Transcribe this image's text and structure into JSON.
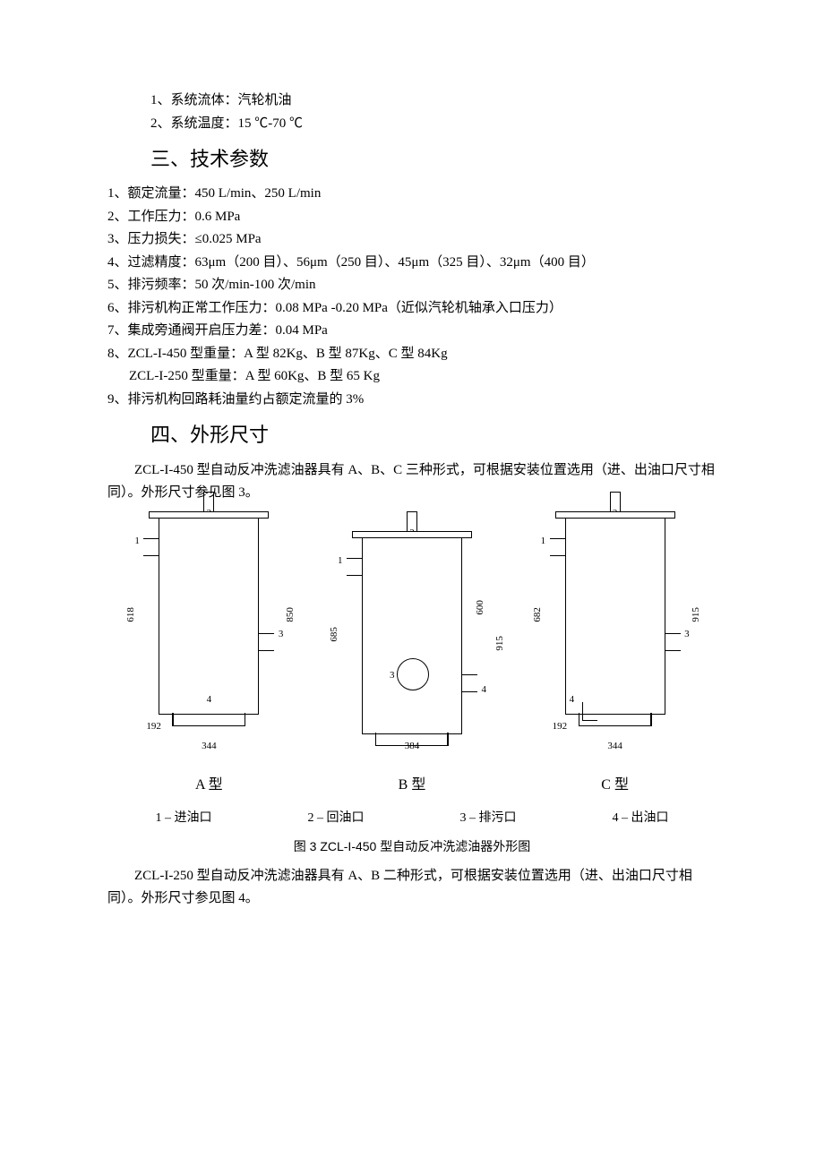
{
  "pretext": {
    "line1": "1、系统流体：汽轮机油",
    "line2": "2、系统温度：15 ℃-70 ℃"
  },
  "section3": {
    "heading": "三、技术参数",
    "items": [
      "1、额定流量：450 L/min、250 L/min",
      "2、工作压力：0.6 MPa",
      "3、压力损失：≤0.025 MPa",
      "4、过滤精度：63μm（200 目）、56μm（250 目）、45μm（325 目）、32μm（400 目）",
      "5、排污频率：50 次/min-100 次/min",
      "6、排污机构正常工作压力：0.08 MPa -0.20 MPa（近似汽轮机轴承入口压力）",
      "7、集成旁通阀开启压力差：0.04 MPa",
      "8、ZCL-I-450 型重量：A 型 82Kg、B 型 87Kg、C 型 84Kg"
    ],
    "sub_item8": "ZCL-I-250 型重量：A 型 60Kg、B 型 65 Kg",
    "item9": "9、排污机构回路耗油量约占额定流量的 3%"
  },
  "section4": {
    "heading": "四、外形尺寸",
    "para1": "ZCL-I-450 型自动反冲洗滤油器具有 A、B、C 三种形式，可根据安装位置选用（进、出油口尺寸相同）。外形尺寸参见图 3。",
    "para2": "ZCL-I-250 型自动反冲洗滤油器具有 A、B 二种形式，可根据安装位置选用（进、出油口尺寸相同）。外形尺寸参见图 4。"
  },
  "figure3": {
    "type_labels": {
      "a": "A 型",
      "b": "B 型",
      "c": "C 型"
    },
    "legend": {
      "l1": "1 – 进油口",
      "l2": "2 – 回油口",
      "l3": "3 – 排污口",
      "l4": "4 – 出油口"
    },
    "caption": "图 3  ZCL-I-450 型自动反冲洗滤油器外形图",
    "dims": {
      "a": {
        "h1": "618",
        "h2": "850",
        "w1": "192",
        "w2": "344",
        "p1": "1",
        "p2": "2",
        "p3": "3",
        "p4": "4"
      },
      "b": {
        "h1": "685",
        "h2": "600",
        "h3": "915",
        "w": "384",
        "p1": "1",
        "p2": "2",
        "p3": "3",
        "p4": "4"
      },
      "c": {
        "h1": "682",
        "h2": "915",
        "w1": "192",
        "w2": "344",
        "p1": "1",
        "p2": "2",
        "p3": "3",
        "p4": "4"
      }
    }
  }
}
